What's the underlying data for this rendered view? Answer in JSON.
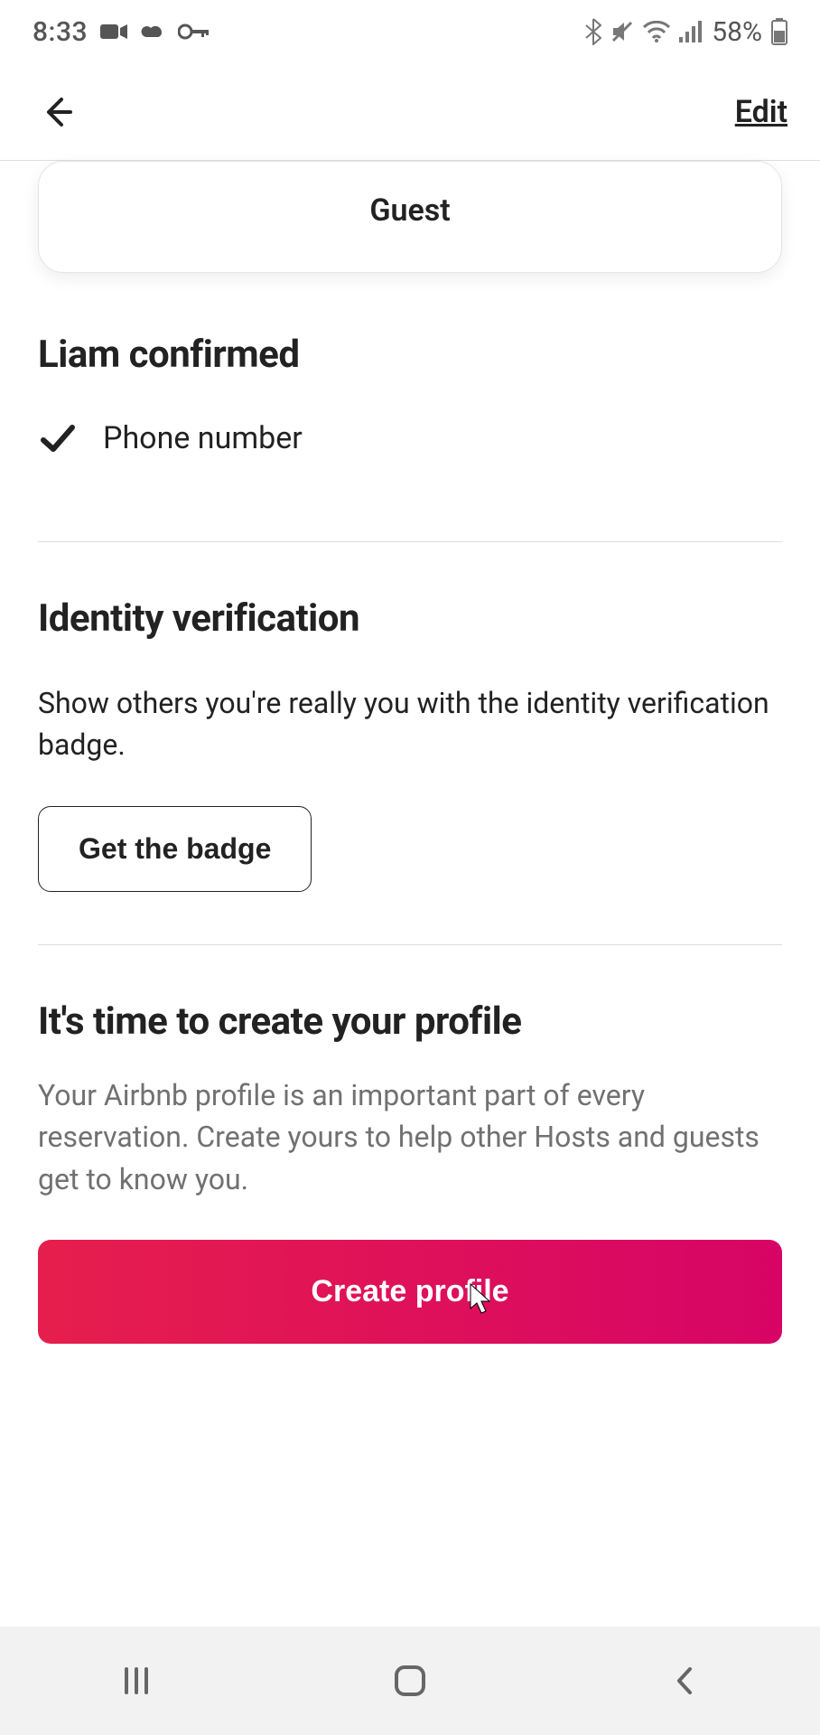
{
  "status_bar": {
    "time": "8:33",
    "battery_percent": "58%"
  },
  "header": {
    "edit_label": "Edit"
  },
  "role_card": {
    "label": "Guest"
  },
  "confirmed_section": {
    "title": "Liam confirmed",
    "item1": "Phone number"
  },
  "identity_section": {
    "title": "Identity verification",
    "body": "Show others you're really you with the identity verification badge.",
    "button": "Get the badge"
  },
  "create_section": {
    "title": "It's time to create your profile",
    "body": "Your Airbnb profile is an important part of every reservation. Create yours to help other Hosts and guests get to know you.",
    "button": "Create profile"
  }
}
